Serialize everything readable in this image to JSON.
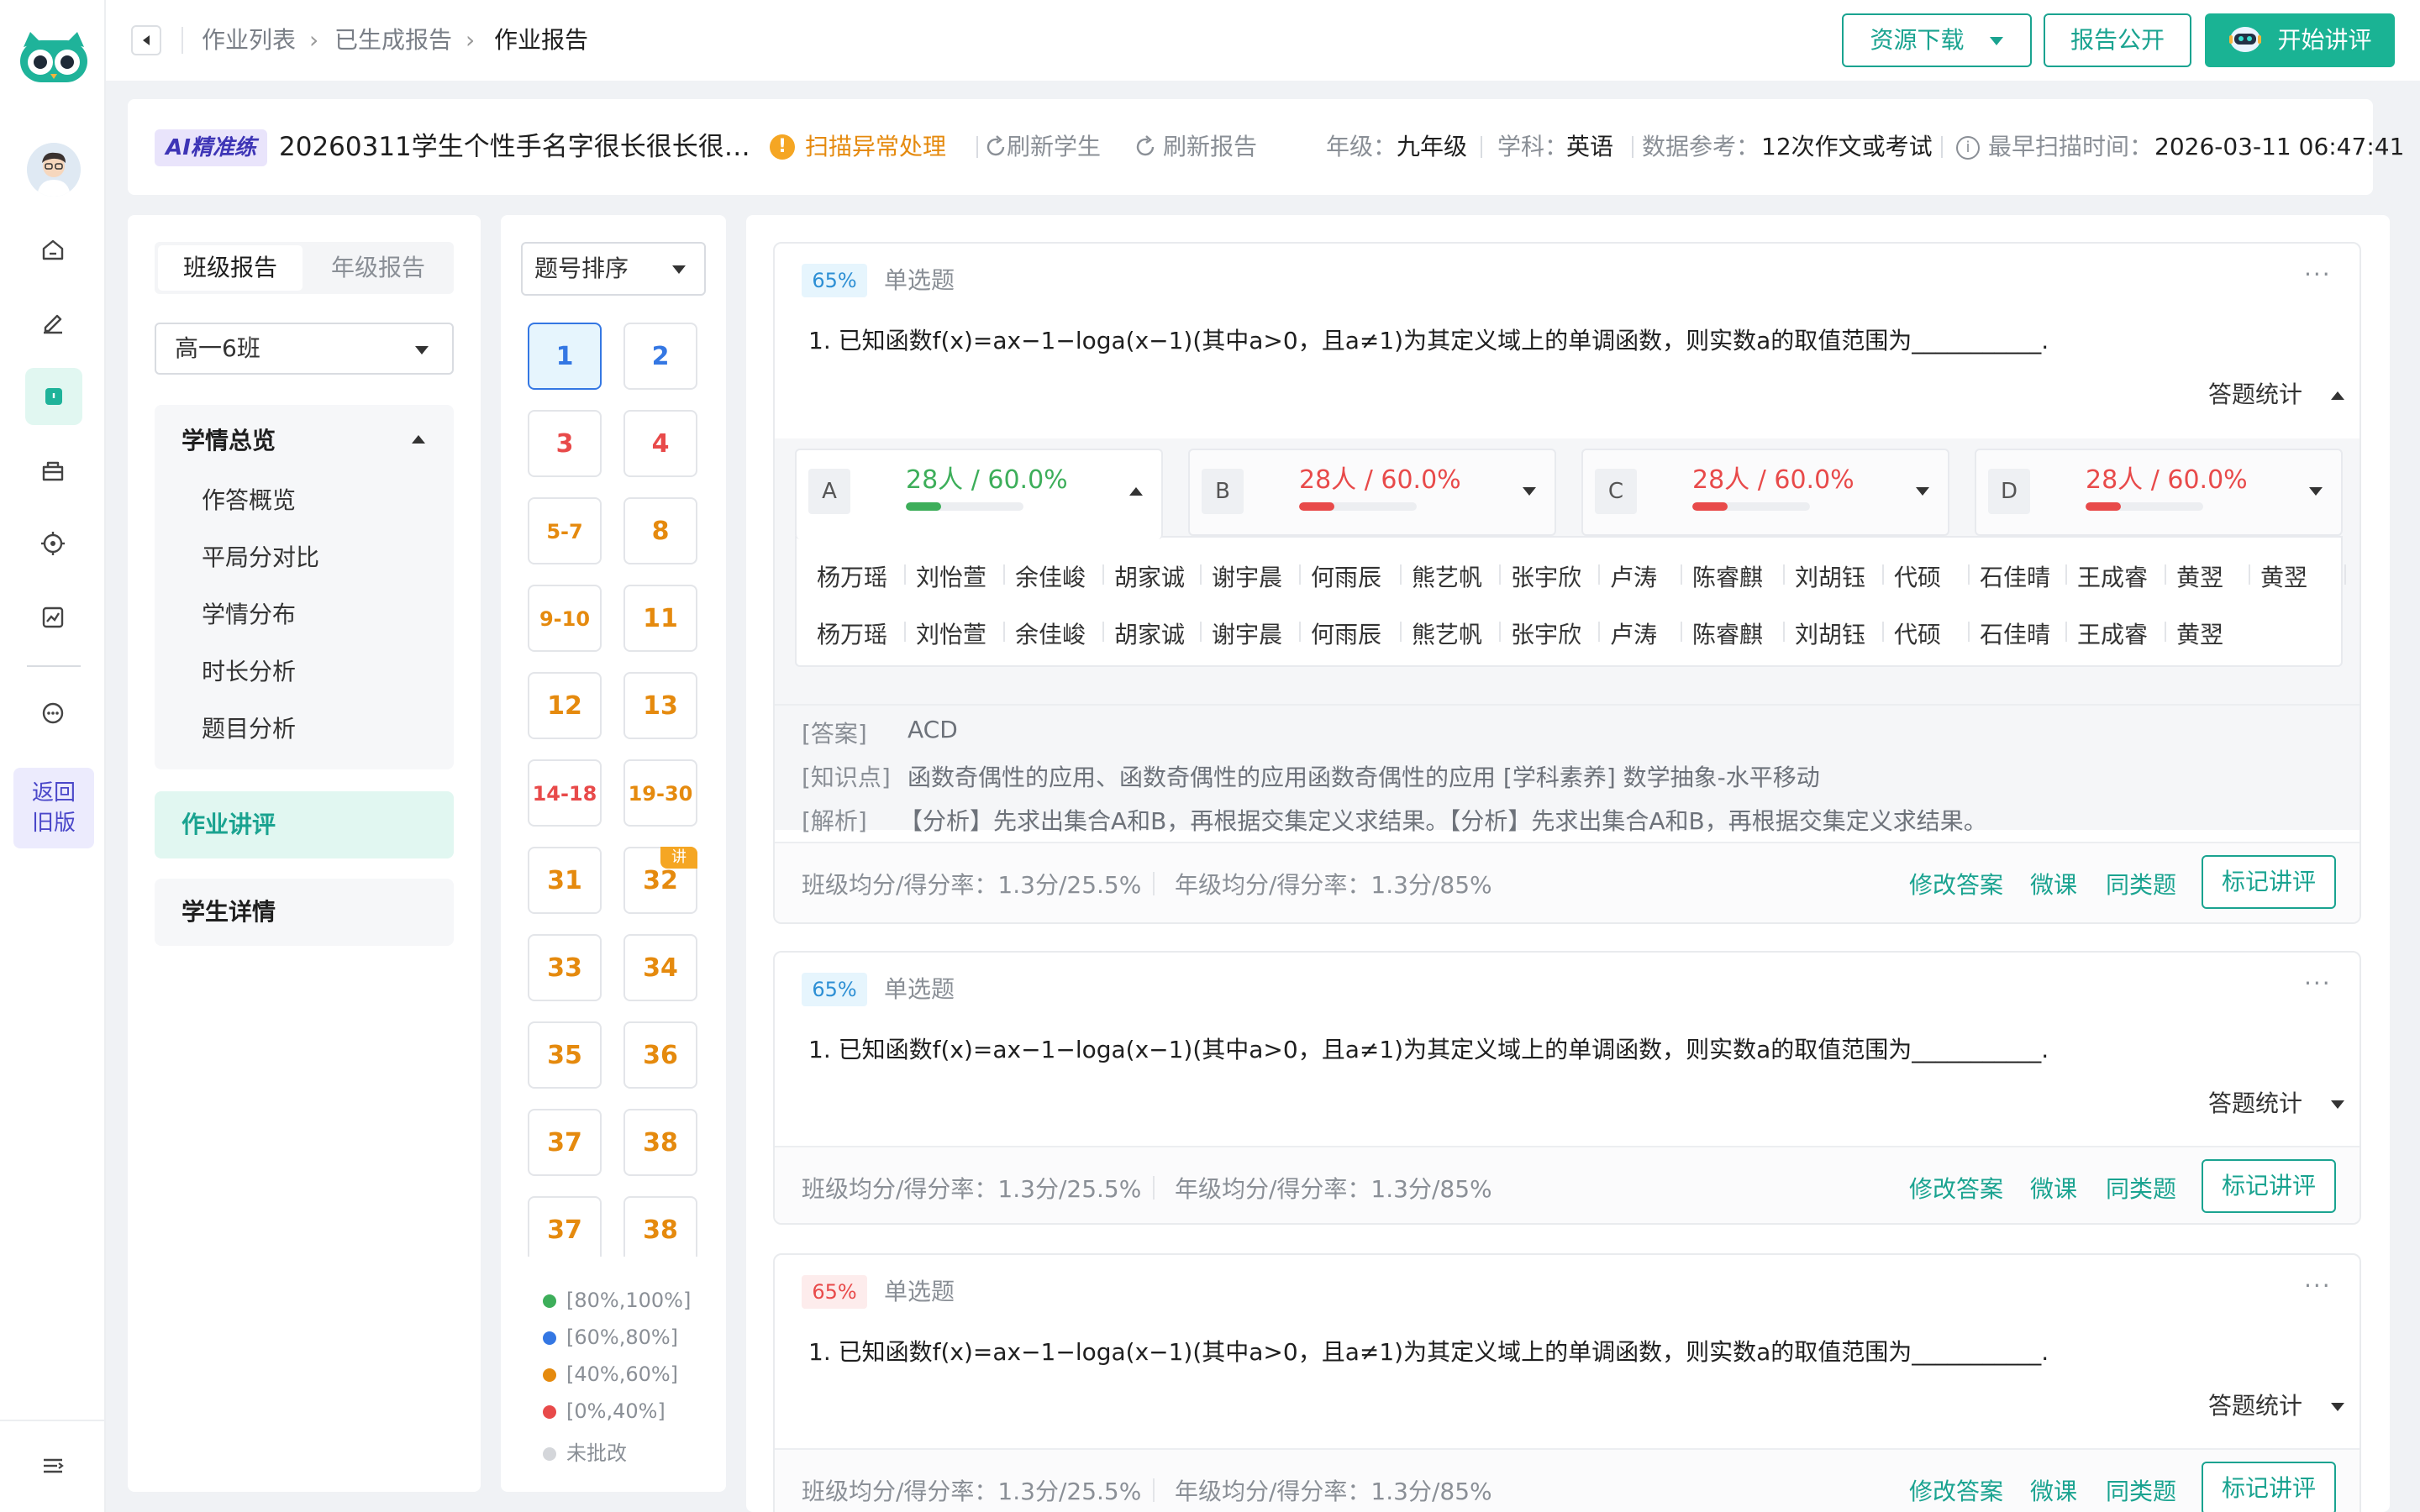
{
  "rail": {
    "back_old_line1": "返回",
    "back_old_line2": "旧版"
  },
  "breadcrumb": {
    "items": [
      "作业列表",
      "已生成报告",
      "作业报告"
    ]
  },
  "top_actions": {
    "download": "资源下载",
    "publish": "报告公开",
    "start": "开始讲评"
  },
  "info": {
    "badge": "AI精准练",
    "title": "20260311学生个性手名字很长很长很…",
    "scan_abnormal": "扫描异常处理",
    "refresh_students": "刷新学生",
    "refresh_report": "刷新报告",
    "grade_label": "年级：",
    "grade_value": "九年级",
    "subject_label": "学科：",
    "subject_value": "英语",
    "ref_label": "数据参考：",
    "ref_value": "12次作文或考试",
    "scan_label": "最早扫描时间：",
    "scan_value": "2026-03-11 06:47:41"
  },
  "left_panel": {
    "tabs": [
      "班级报告",
      "年级报告"
    ],
    "class_select": "高一6班",
    "section_title": "学情总览",
    "section_items": [
      "作答概览",
      "平局分对比",
      "学情分布",
      "时长分析",
      "题目分析"
    ],
    "homework_review": "作业讲评",
    "student_detail": "学生详情"
  },
  "qnav": {
    "sort_select": "题号排序",
    "buttons": [
      {
        "label": "1",
        "level": "selected"
      },
      {
        "label": "2",
        "level": "blue"
      },
      {
        "label": "3",
        "level": "red"
      },
      {
        "label": "4",
        "level": "red"
      },
      {
        "label": "5-7",
        "level": "orange"
      },
      {
        "label": "8",
        "level": "orange"
      },
      {
        "label": "9-10",
        "level": "orange"
      },
      {
        "label": "11",
        "level": "orange"
      },
      {
        "label": "12",
        "level": "orange"
      },
      {
        "label": "13",
        "level": "orange"
      },
      {
        "label": "14-18",
        "level": "red"
      },
      {
        "label": "19-30",
        "level": "orange"
      },
      {
        "label": "31",
        "level": "orange"
      },
      {
        "label": "32",
        "level": "orange",
        "tag": "讲"
      },
      {
        "label": "33",
        "level": "orange"
      },
      {
        "label": "34",
        "level": "orange"
      },
      {
        "label": "35",
        "level": "orange"
      },
      {
        "label": "36",
        "level": "orange"
      },
      {
        "label": "37",
        "level": "orange"
      },
      {
        "label": "38",
        "level": "orange"
      },
      {
        "label": "37",
        "level": "orange"
      },
      {
        "label": "38",
        "level": "orange"
      }
    ],
    "legend": [
      {
        "label": "[80%,100%]",
        "color": "#3dae5a"
      },
      {
        "label": "[60%,80%]",
        "color": "#3477e3"
      },
      {
        "label": "[40%,60%]",
        "color": "#e58a0e"
      },
      {
        "label": "[0%,40%]",
        "color": "#e84a4a"
      },
      {
        "label": "未批改",
        "color": "#d4d6da"
      }
    ]
  },
  "questions": [
    {
      "pct": "65%",
      "type": "单选题",
      "text": "1. 已知函数f(x)=ax−1−loga(x−1)(其中a>0，且a≠1)为其定义域上的单调函数，则实数a的取值范围为___________.",
      "stats_toggle": "答题统计",
      "options": [
        {
          "label": "A",
          "value": "28人 / 60.0%",
          "fill": 0.6,
          "color": "#3dae5a"
        },
        {
          "label": "B",
          "value": "28人 / 60.0%",
          "fill": 0.6,
          "color": "#e84a4a"
        },
        {
          "label": "C",
          "value": "28人 / 60.0%",
          "fill": 0.6,
          "color": "#e84a4a"
        },
        {
          "label": "D",
          "value": "28人 / 60.0%",
          "fill": 0.6,
          "color": "#e84a4a"
        }
      ],
      "names_row1": [
        "杨万瑶",
        "刘怡萱",
        "余佳峻",
        "胡家诚",
        "谢宇晨",
        "何雨辰",
        "熊艺帆",
        "张宇欣",
        "卢涛",
        "陈睿麒",
        "刘胡钰",
        "代硕",
        "石佳晴",
        "王成睿",
        "黄翌",
        "黄翌"
      ],
      "names_row2": [
        "杨万瑶",
        "刘怡萱",
        "余佳峻",
        "胡家诚",
        "谢宇晨",
        "何雨辰",
        "熊艺帆",
        "张宇欣",
        "卢涛",
        "陈睿麒",
        "刘胡钰",
        "代硕",
        "石佳晴",
        "王成睿",
        "黄翌"
      ],
      "answer_label": "[答案]",
      "answer": "ACD",
      "knowledge_label": "[知识点]",
      "knowledge": "函数奇偶性的应用、函数奇偶性的应用函数奇偶性的应用  [学科素养] 数学抽象-水平移动",
      "analysis_label": "[解析]",
      "analysis": "【分析】先求出集合A和B，再根据交集定义求结果。【分析】先求出集合A和B，再根据交集定义求结果。",
      "class_avg": "班级均分/得分率：1.3分/25.5%",
      "grade_avg": "年级均分/得分率：1.3分/85%",
      "actions": [
        "修改答案",
        "微课",
        "同类题"
      ],
      "mark": "标记讲评"
    },
    {
      "pct": "65%",
      "type": "单选题",
      "text": "1. 已知函数f(x)=ax−1−loga(x−1)(其中a>0，且a≠1)为其定义域上的单调函数，则实数a的取值范围为___________.",
      "stats_toggle": "答题统计",
      "class_avg": "班级均分/得分率：1.3分/25.5%",
      "grade_avg": "年级均分/得分率：1.3分/85%",
      "actions": [
        "修改答案",
        "微课",
        "同类题"
      ],
      "mark": "标记讲评"
    },
    {
      "pct": "65%",
      "type": "单选题",
      "text": "1. 已知函数f(x)=ax−1−loga(x−1)(其中a>0，且a≠1)为其定义域上的单调函数，则实数a的取值范围为___________.",
      "stats_toggle": "答题统计",
      "class_avg": "班级均分/得分率：1.3分/25.5%",
      "grade_avg": "年级均分/得分率：1.3分/85%",
      "actions": [
        "修改答案",
        "微课",
        "同类题"
      ],
      "mark": "标记讲评"
    }
  ],
  "colors": {
    "brand": "#1aa390",
    "green": "#3dae5a",
    "blue": "#3477e3",
    "orange": "#e58a0e",
    "red": "#e84a4a",
    "pct_blue_bg": "#e6f5fd",
    "pct_red_bg": "#fdecec"
  }
}
